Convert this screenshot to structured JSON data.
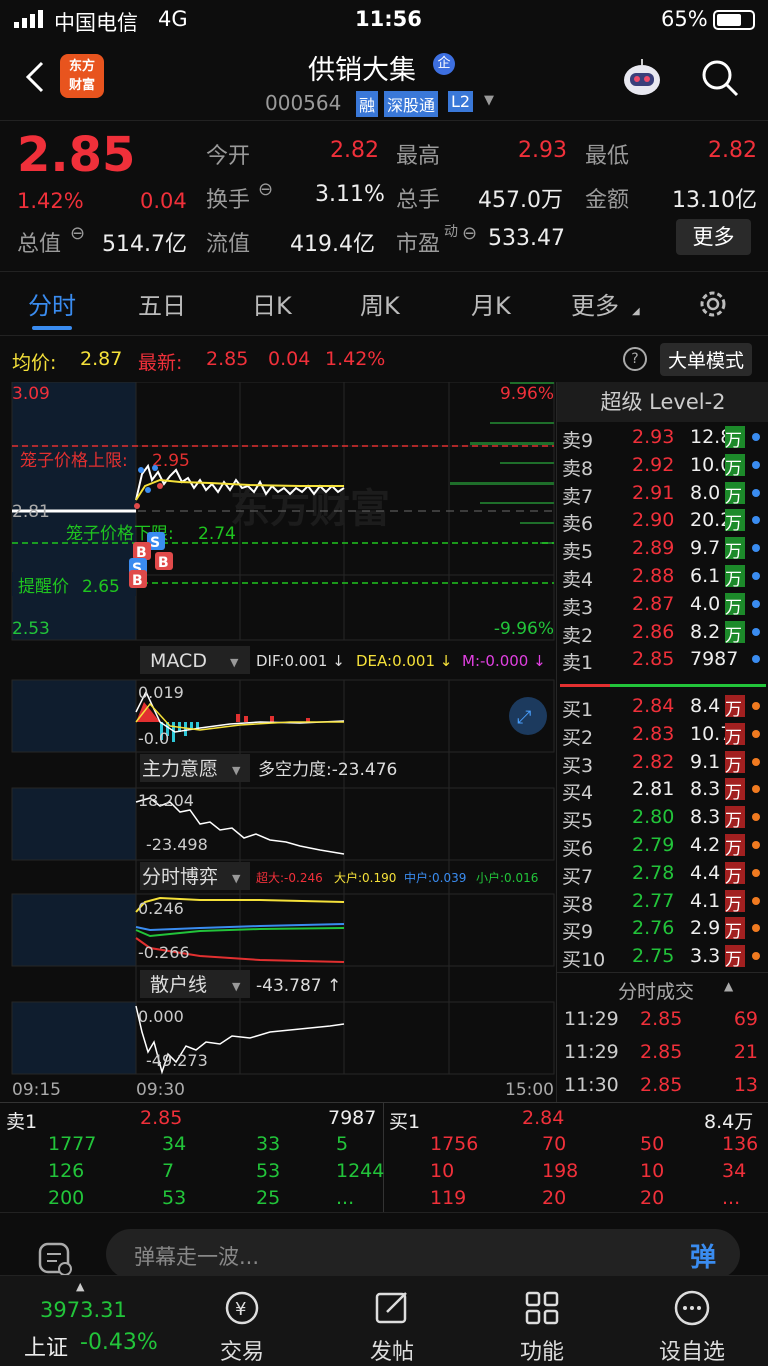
{
  "status": {
    "carrier": "中国电信",
    "network": "4G",
    "time": "11:56",
    "battery": "65%"
  },
  "header": {
    "name": "供销大集",
    "badge": "企",
    "code": "000564",
    "tag_rong": "融",
    "tag_sgt": "深股通",
    "tag_l2": "L2",
    "logo_line1": "东方",
    "logo_line2": "财富"
  },
  "quote": {
    "price": "2.85",
    "pct": "1.42%",
    "change": "0.04",
    "open_label": "今开",
    "open": "2.82",
    "high_label": "最高",
    "high": "2.93",
    "low_label": "最低",
    "low": "2.82",
    "turnover_label": "换手",
    "turnover": "3.11%",
    "vol_label": "总手",
    "vol": "457.0万",
    "amount_label": "金额",
    "amount": "13.10亿",
    "mcap_label": "总值",
    "mcap": "514.7亿",
    "float_label": "流值",
    "float": "419.4亿",
    "pe_label": "市盈",
    "pe_sup": "动",
    "pe": "533.47",
    "more": "更多"
  },
  "tabs": [
    "分时",
    "五日",
    "日K",
    "周K",
    "月K",
    "更多"
  ],
  "infobar": {
    "avg_label": "均价:",
    "avg": "2.87",
    "last_label": "最新:",
    "last": "2.85",
    "change": "0.04",
    "pct": "1.42%",
    "mode_button": "大单模式"
  },
  "chart": {
    "top_price": "3.09",
    "bottom_price": "2.53",
    "top_pct": "9.96%",
    "bottom_pct": "-9.96%",
    "ref_price": "2.81",
    "cage_upper_label": "笼子价格上限:",
    "cage_upper": "2.95",
    "cage_lower_label": "笼子价格下限:",
    "cage_lower": "2.74",
    "alert_label": "提醒价",
    "alert": "2.65",
    "watermark": "东方财富",
    "time_start": "09:15",
    "time_open": "09:30",
    "time_end": "15:00"
  },
  "macd": {
    "name": "MACD",
    "dif": "DIF:0.001 ↓",
    "dea": "DEA:0.001 ↓",
    "m": "M:-0.000 ↓",
    "top": "0.019",
    "bottom": "-0.0"
  },
  "zlyy": {
    "name": "主力意愿",
    "label": "多空力度:-23.476",
    "top": "18.204",
    "bottom": "-23.498"
  },
  "fsby": {
    "name": "分时博弈",
    "big": "超大:-0.246",
    "large": "大户:0.190",
    "mid": "中户:0.039",
    "small": "小户:0.016",
    "top": "0.246",
    "bottom": "-0.266"
  },
  "shx": {
    "name": "散户线",
    "label": "-43.787 ↑",
    "top": "0.000",
    "bottom": "-49.273"
  },
  "level2": {
    "title": "超级 Level-2",
    "asks": [
      {
        "label": "卖9",
        "price": "2.93",
        "vol": "12.8",
        "unit": "万"
      },
      {
        "label": "卖8",
        "price": "2.92",
        "vol": "10.0",
        "unit": "万"
      },
      {
        "label": "卖7",
        "price": "2.91",
        "vol": "8.0",
        "unit": "万"
      },
      {
        "label": "卖6",
        "price": "2.90",
        "vol": "20.2",
        "unit": "万"
      },
      {
        "label": "卖5",
        "price": "2.89",
        "vol": "9.7",
        "unit": "万"
      },
      {
        "label": "卖4",
        "price": "2.88",
        "vol": "6.1",
        "unit": "万"
      },
      {
        "label": "卖3",
        "price": "2.87",
        "vol": "4.0",
        "unit": "万"
      },
      {
        "label": "卖2",
        "price": "2.86",
        "vol": "8.2",
        "unit": "万"
      },
      {
        "label": "卖1",
        "price": "2.85",
        "vol": "7987",
        "unit": ""
      }
    ],
    "bids": [
      {
        "label": "买1",
        "price": "2.84",
        "vol": "8.4",
        "unit": "万"
      },
      {
        "label": "买2",
        "price": "2.83",
        "vol": "10.7",
        "unit": "万"
      },
      {
        "label": "买3",
        "price": "2.82",
        "vol": "9.1",
        "unit": "万"
      },
      {
        "label": "买4",
        "price": "2.81",
        "vol": "8.3",
        "unit": "万"
      },
      {
        "label": "买5",
        "price": "2.80",
        "vol": "8.3",
        "unit": "万"
      },
      {
        "label": "买6",
        "price": "2.79",
        "vol": "4.2",
        "unit": "万"
      },
      {
        "label": "买7",
        "price": "2.78",
        "vol": "4.4",
        "unit": "万"
      },
      {
        "label": "买8",
        "price": "2.77",
        "vol": "4.1",
        "unit": "万"
      },
      {
        "label": "买9",
        "price": "2.76",
        "vol": "2.9",
        "unit": "万"
      },
      {
        "label": "买10",
        "price": "2.75",
        "vol": "3.3",
        "unit": "万"
      }
    ],
    "trades_title": "分时成交",
    "trades": [
      {
        "time": "11:29",
        "price": "2.85",
        "vol": "69"
      },
      {
        "time": "11:29",
        "price": "2.85",
        "vol": "21"
      },
      {
        "time": "11:30",
        "price": "2.85",
        "vol": "13"
      }
    ]
  },
  "queue": {
    "sell_label": "卖1",
    "sell_price": "2.85",
    "sell_vol": "7987",
    "buy_label": "买1",
    "buy_price": "2.84",
    "buy_vol": "8.4万",
    "sell_rows": [
      [
        "1777",
        "34",
        "33",
        "5"
      ],
      [
        "126",
        "7",
        "53",
        "1244"
      ],
      [
        "200",
        "53",
        "25",
        "..."
      ]
    ],
    "buy_rows": [
      [
        "1756",
        "70",
        "50",
        "136"
      ],
      [
        "10",
        "198",
        "10",
        "34"
      ],
      [
        "119",
        "20",
        "20",
        "..."
      ]
    ]
  },
  "danmu": {
    "placeholder": "弹幕走一波...",
    "button": "弹"
  },
  "bottom": {
    "index_value": "3973.31",
    "index_name": "上证",
    "index_pct": "-0.43%",
    "trade": "交易",
    "post": "发帖",
    "func": "功能",
    "watch": "设自选"
  }
}
